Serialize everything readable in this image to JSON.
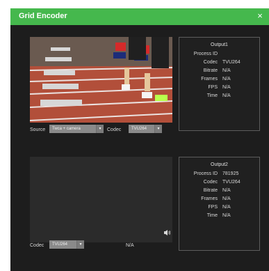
{
  "window": {
    "title": "Grid Encoder",
    "close_glyph": "×",
    "title_bar_color": "#45b84d"
  },
  "preview1": {
    "source_label": "Source",
    "source_value": "Twca + camera",
    "codec_label": "Codec",
    "codec_value": "TVU264"
  },
  "output1": {
    "title": "Output1",
    "rows": [
      {
        "key": "Process ID",
        "value": ""
      },
      {
        "key": "Codec",
        "value": "TVU264"
      },
      {
        "key": "Bitrate",
        "value": "N/A"
      },
      {
        "key": "Frames",
        "value": "N/A"
      },
      {
        "key": "FPS",
        "value": "N/A"
      },
      {
        "key": "Time",
        "value": "N/A"
      }
    ]
  },
  "preview2": {
    "codec_label": "Codec",
    "codec_value": "TVU264",
    "status": "N/A",
    "audio_icon": "speaker-icon"
  },
  "output2": {
    "title": "Output2",
    "rows": [
      {
        "key": "Process ID",
        "value": "781925"
      },
      {
        "key": "Codec",
        "value": "TVU264"
      },
      {
        "key": "Bitrate",
        "value": "N/A"
      },
      {
        "key": "Frames",
        "value": "N/A"
      },
      {
        "key": "FPS",
        "value": "N/A"
      },
      {
        "key": "Time",
        "value": "N/A"
      }
    ]
  }
}
